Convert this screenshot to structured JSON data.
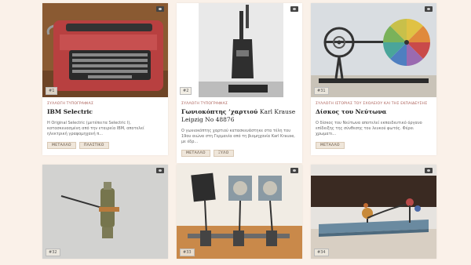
{
  "cards": [
    {
      "number": "#1",
      "collection": "ΣΥΛΛΟΓΗ ΤΥΠΟΓΡΑΦΙΑΣ",
      "title": "IBM Selectric",
      "title_sub": "",
      "description": "Η Original Selectric (μετέπειτα Selectric I), κατασκευασμένη από την εταιρεία IBM, αποτελεί ηλεκτρική γραφομηχανή π...",
      "tags": [
        "ΜΕΤΑΛΛΟ",
        "ΠΛΑΣΤΙΚΟ"
      ]
    },
    {
      "number": "#2",
      "collection": "ΣΥΛΛΟΓΗ ΤΥΠΟΓΡΑΦΙΑΣ",
      "title": "Γωνιοκόπτης ’χαρτιού",
      "title_sub": "Karl Krause Leipzig No 48876",
      "description": "Ο γωνιοκόπτης χαρτιού κατασκευάστηκε στα τέλη του 19ου αιώνα στη Γερμανία από τη βιομηχανία Karl Krause, με έδρ...",
      "tags": [
        "ΜΕΤΑΛΛΟ",
        "ΞΥΛΟ"
      ]
    },
    {
      "number": "#31",
      "collection": "ΣΥΛΛΟΓΗ ΙΣΤΟΡΙΑΣ ΤΟΥ ΣΧΟΛΕΙΟΥ ΚΑΙ ΤΗΣ ΕΚΠΑΙΔΕΥΣΗΣ",
      "title": "Δίσκος του Νεύτωνα",
      "title_sub": "",
      "description": "Ο δίσκος του Νεύτωνα αποτελεί εκπαιδευτικό όργανο επίδειξης της σύνθεσης του λευκού φωτός. Φέρει χρωματι...",
      "tags": [
        "ΜΕΤΑΛΛΟ"
      ]
    },
    {
      "number": "#32"
    },
    {
      "number": "#33"
    },
    {
      "number": "#34"
    }
  ]
}
